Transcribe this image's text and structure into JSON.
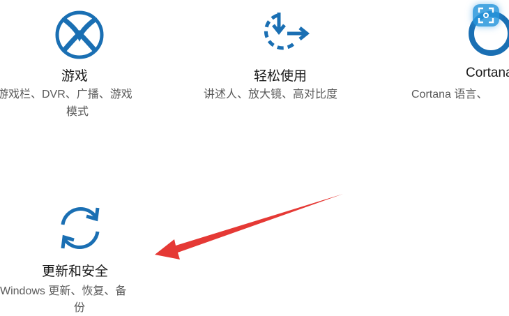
{
  "settings_tiles": [
    {
      "id": "gaming",
      "icon": "xbox-icon",
      "title": "游戏",
      "description_line1": "游戏栏、DVR、广播、游戏",
      "description_line2": "模式"
    },
    {
      "id": "ease_of_access",
      "icon": "ease-of-access-icon",
      "title": "轻松使用",
      "description_line1": "讲述人、放大镜、高对比度"
    },
    {
      "id": "cortana",
      "icon": "cortana-icon",
      "title": "Cortana",
      "description_line1": "Cortana 语言、"
    },
    {
      "id": "update_security",
      "icon": "sync-icon",
      "title": "更新和安全",
      "description_line1": "Windows 更新、恢复、备",
      "description_line2": "份"
    }
  ],
  "colors": {
    "accent": "#1a6fb3",
    "title_text": "#1a1a1a",
    "description_text": "#5a5a5a",
    "annotation_arrow": "#e53935"
  },
  "overlay": {
    "capture_button_icon": "screen-capture-icon"
  },
  "annotation": {
    "type": "arrow",
    "points_to": "update_security"
  }
}
